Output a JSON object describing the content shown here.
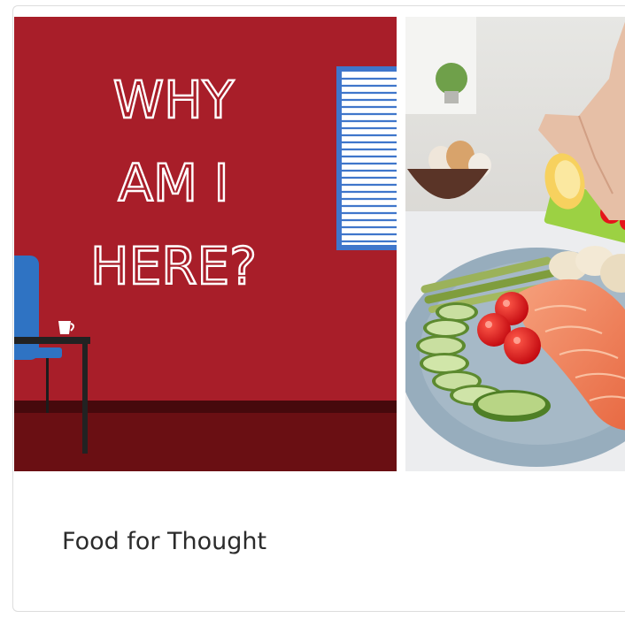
{
  "card": {
    "title": "Food for Thought"
  },
  "illustration": {
    "headline_lines": [
      "WHY",
      "AM I",
      "HERE?"
    ],
    "colors": {
      "wall": "#a81e29",
      "floor": "#6a0f13",
      "baseboard": "#46090c",
      "window_frame": "#3f76cb",
      "chair": "#2f73c3",
      "table": "#222222"
    }
  },
  "photo": {
    "subject": "plate-salmon-cucumber-tomato-asparagus-lemon",
    "colors": {
      "kitchen": "#e5e5e3",
      "plate": "#9fb3c1",
      "salmon": "#f0815a",
      "cucumber": "#82a94a",
      "tomato": "#e0171b",
      "lemon": "#f7d15e"
    }
  }
}
